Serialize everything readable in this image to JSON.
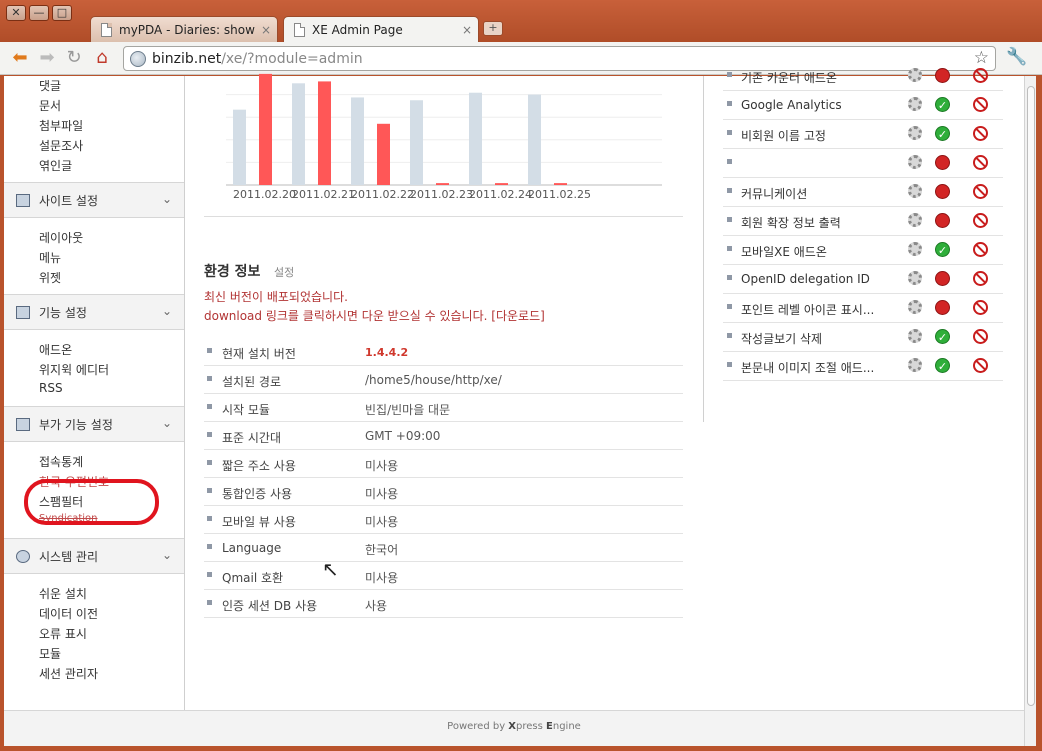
{
  "browser": {
    "window_buttons": [
      "✕",
      "—",
      "□"
    ],
    "tabs": [
      {
        "label": "myPDA - Diaries: show",
        "close": "×"
      },
      {
        "label": "XE Admin Page",
        "close": "×"
      }
    ],
    "new_tab": "+",
    "url_host": "binzib.net",
    "url_path": "/xe/?module=admin"
  },
  "sidebar": {
    "top_links": [
      "댓글",
      "문서",
      "첨부파일",
      "설문조사",
      "엮인글"
    ],
    "sections": [
      {
        "title": "사이트 설정",
        "links": [
          "레이아웃",
          "메뉴",
          "위젯"
        ]
      },
      {
        "title": "기능 설정",
        "links": [
          "애드온",
          "위지윅 에디터",
          "RSS"
        ]
      },
      {
        "title": "부가 기능 설정",
        "links": [
          "접속통계",
          "한국 우편번호",
          "스팸필터",
          "Syndication"
        ]
      },
      {
        "title": "시스템 관리",
        "links": [
          "쉬운 설치",
          "데이터 이전",
          "오류 표시",
          "모듈",
          "세션 관리자"
        ]
      }
    ]
  },
  "chart_data": {
    "type": "bar",
    "categories": [
      "2011.02.20",
      "2011.02.21",
      "2011.02.22",
      "2011.02.23",
      "2011.02.24",
      "2011.02.25"
    ],
    "series": [
      {
        "values": [
          80,
          108,
          93,
          90,
          98,
          96
        ]
      },
      {
        "values": [
          118,
          110,
          65,
          2,
          2,
          2
        ]
      }
    ],
    "ylim": [
      0,
      120
    ],
    "colors": [
      "#d3dde6",
      "#ff5757"
    ]
  },
  "env": {
    "title": "환경 정보",
    "setting_link": "설정",
    "notice_1": "최신 버전이 배포되었습니다.",
    "notice_2": "download 링크를 클릭하시면 다운 받으실 수 있습니다. [다운로드]",
    "rows": [
      {
        "key": "현재 설치 버전",
        "value": "1.4.4.2"
      },
      {
        "key": "설치된 경로",
        "value": "/home5/house/http/xe/"
      },
      {
        "key": "시작 모듈",
        "value": "빈집/빈마을 대문"
      },
      {
        "key": "표준 시간대",
        "value": "GMT +09:00"
      },
      {
        "key": "짧은 주소 사용",
        "value": "미사용"
      },
      {
        "key": "통합인증 사용",
        "value": "미사용"
      },
      {
        "key": "모바일 뷰 사용",
        "value": "미사용"
      },
      {
        "key": "Language",
        "value": "한국어"
      },
      {
        "key": "Qmail 호환",
        "value": "미사용"
      },
      {
        "key": "인증 세션 DB 사용",
        "value": "사용"
      }
    ]
  },
  "addons": [
    {
      "name": "기존 카운터 애드온",
      "active": false
    },
    {
      "name": "Google Analytics",
      "active": true
    },
    {
      "name": "비회원 이름 고정",
      "active": true
    },
    {
      "name": "",
      "active": false
    },
    {
      "name": "커뮤니케이션",
      "active": false
    },
    {
      "name": "회원 확장 정보 출력",
      "active": false
    },
    {
      "name": "모바일XE 애드온",
      "active": true
    },
    {
      "name": "OpenID delegation ID",
      "active": false
    },
    {
      "name": "포인트 레벨 아이콘 표시...",
      "active": false
    },
    {
      "name": "작성글보기 삭제",
      "active": true
    },
    {
      "name": "본문내 이미지 조절 애드...",
      "active": true
    }
  ],
  "footer": {
    "prefix": "Powered by ",
    "brand_x": "X",
    "brand_mid": "press ",
    "brand_e": "E",
    "brand_end": "ngine"
  }
}
